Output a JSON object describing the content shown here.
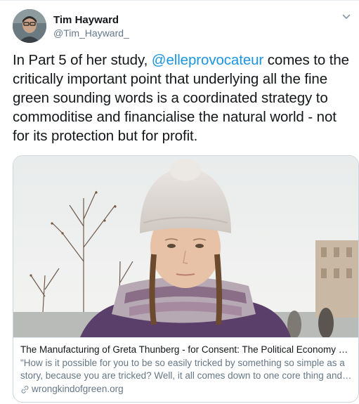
{
  "user": {
    "name": "Tim Hayward",
    "handle": "@Tim_Hayward_"
  },
  "tweet": {
    "text_before": "In Part 5 of her study, ",
    "mention": "@elleprovocateur",
    "text_after": " comes to the critically important point that underlying all the fine green sounding words is a coordinated strategy to commoditise and financialise the natural world - not for its protection but for profit."
  },
  "card": {
    "title": "The Manufacturing of Greta Thunberg - for Consent: The Political Economy of the Non-Profit Industrial Complex",
    "description": "\"How is it possible for you to be so easily tricked by something so simple as a story, because you are tricked? Well, it all comes down to one core thing and that is...",
    "domain": "wrongkindofgreen.org"
  },
  "icons": {
    "caret": "chevron-down-icon",
    "link": "link-icon"
  },
  "colors": {
    "mention": "#1b95e0",
    "secondary_text": "#657786",
    "border": "#ccd6dd"
  }
}
